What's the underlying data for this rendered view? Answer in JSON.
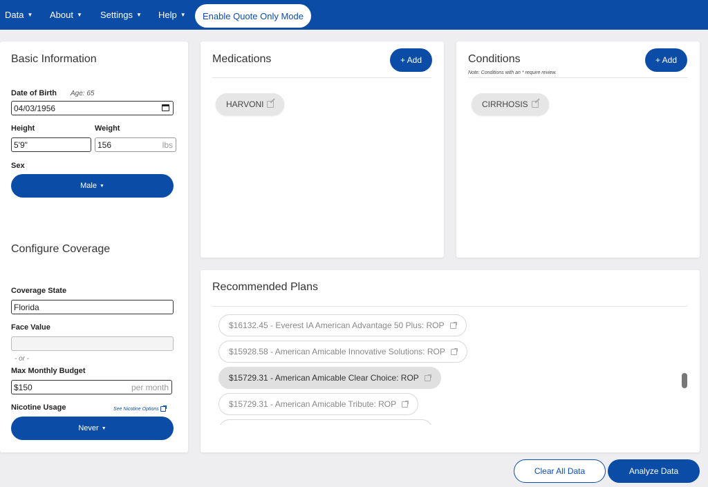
{
  "nav": {
    "items": [
      {
        "label": "Data"
      },
      {
        "label": "About"
      },
      {
        "label": "Settings"
      },
      {
        "label": "Help"
      }
    ],
    "quote_mode_label": "Enable Quote Only Mode"
  },
  "basic": {
    "title": "Basic Information",
    "dob_label": "Date of Birth",
    "age": "Age: 65",
    "dob_value": "04/03/1956",
    "height_label": "Height",
    "height_value": "5'9\"",
    "weight_label": "Weight",
    "weight_value": "156",
    "weight_unit": "lbs",
    "sex_label": "Sex",
    "sex_value": "Male"
  },
  "coverage": {
    "title": "Configure Coverage",
    "state_label": "Coverage State",
    "state_value": "Florida",
    "face_label": "Face Value",
    "face_value": "",
    "or_text": "- or -",
    "budget_label": "Max Monthly Budget",
    "budget_value": "$150",
    "budget_unit": "per month",
    "nicotine_label": "Nicotine Usage",
    "nicotine_link": "See Nicotine Options",
    "nicotine_value": "Never"
  },
  "medications": {
    "title": "Medications",
    "add_label": "+ Add",
    "items": [
      "HARVONI"
    ]
  },
  "conditions": {
    "title": "Conditions",
    "add_label": "+ Add",
    "note": "Note: Conditions with an * require review.",
    "items": [
      "CIRRHOSIS"
    ]
  },
  "plans": {
    "title": "Recommended Plans",
    "items": [
      {
        "label": "$16132.45 - Everest IA American Advantage 50 Plus: ROP"
      },
      {
        "label": "$15928.58 - American Amicable Innovative Solutions: ROP"
      },
      {
        "label": "$15729.31 - American Amicable Clear Choice: ROP"
      },
      {
        "label": "$15729.31 - American Amicable Tribute: ROP"
      }
    ]
  },
  "actions": {
    "clear_label": "Clear All Data",
    "analyze_label": "Analyze Data"
  },
  "colors": {
    "brand": "#0b4da6",
    "background": "#eeeef0"
  }
}
